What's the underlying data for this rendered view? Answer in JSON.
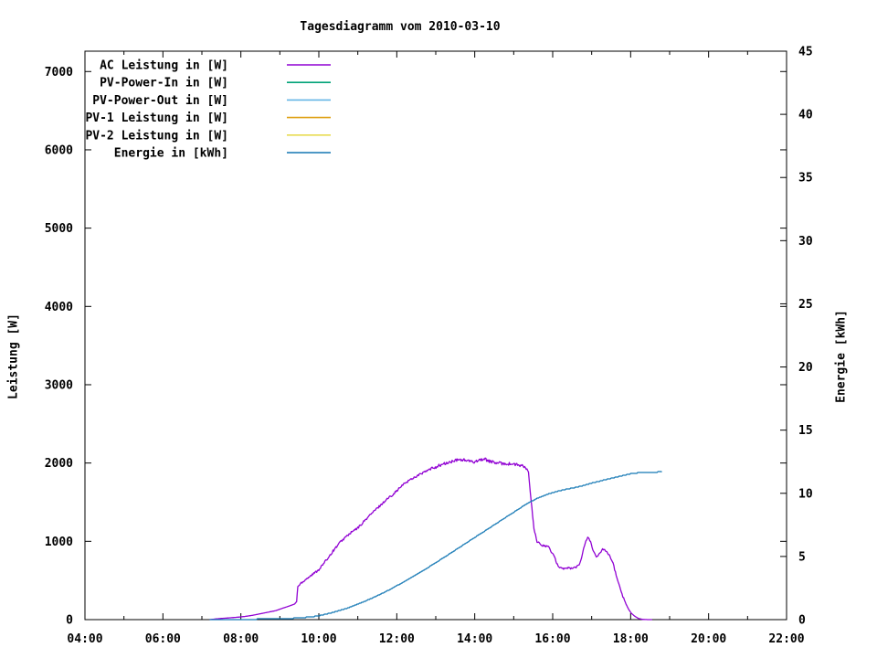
{
  "chart_data": {
    "type": "line",
    "title": "Tagesdiagramm vom 2010-03-10",
    "x_axis": {
      "range_hours": [
        4,
        22
      ],
      "major_tick_step_hours": 2,
      "minor_tick_step_hours": 1,
      "tick_labels": [
        "04:00",
        "06:00",
        "08:00",
        "10:00",
        "12:00",
        "14:00",
        "16:00",
        "18:00",
        "20:00",
        "22:00"
      ]
    },
    "y_axis": {
      "label": "Leistung [W]",
      "range": [
        0,
        7260
      ],
      "tick_step": 1000,
      "tick_labels": [
        "0",
        "1000",
        "2000",
        "3000",
        "4000",
        "5000",
        "6000",
        "7000"
      ]
    },
    "y2_axis": {
      "label": "Energie [kWh]",
      "range": [
        0,
        45
      ],
      "tick_step": 5,
      "tick_labels": [
        "0",
        "5",
        "10",
        "15",
        "20",
        "25",
        "30",
        "35",
        "40",
        "45"
      ]
    },
    "legend": {
      "position": "top-left-inside",
      "items": [
        {
          "label": "AC Leistung in [W]",
          "color": "#9102d3"
        },
        {
          "label": "PV-Power-In in [W]",
          "color": "#00a278"
        },
        {
          "label": "PV-Power-Out in [W]",
          "color": "#64b5e6"
        },
        {
          "label": "PV-1 Leistung in [W]",
          "color": "#dfa012"
        },
        {
          "label": "PV-2 Leistung in [W]",
          "color": "#e8dc52"
        },
        {
          "label": "Energie in [kWh]",
          "color": "#1377b4"
        }
      ]
    },
    "grid": "off",
    "series": [
      {
        "name": "AC Leistung in [W]",
        "axis": "y1",
        "color": "#9102d3",
        "jitter_w": 14,
        "points": [
          [
            7.2,
            0
          ],
          [
            7.35,
            8
          ],
          [
            7.5,
            15
          ],
          [
            7.7,
            22
          ],
          [
            7.9,
            30
          ],
          [
            8.1,
            40
          ],
          [
            8.3,
            55
          ],
          [
            8.5,
            75
          ],
          [
            8.7,
            95
          ],
          [
            8.9,
            115
          ],
          [
            9.1,
            150
          ],
          [
            9.25,
            175
          ],
          [
            9.38,
            200
          ],
          [
            9.43,
            230
          ],
          [
            9.46,
            420
          ],
          [
            9.55,
            470
          ],
          [
            9.7,
            530
          ],
          [
            9.85,
            580
          ],
          [
            10.0,
            640
          ],
          [
            10.1,
            700
          ],
          [
            10.25,
            800
          ],
          [
            10.4,
            900
          ],
          [
            10.55,
            990
          ],
          [
            10.7,
            1060
          ],
          [
            10.85,
            1120
          ],
          [
            11.0,
            1170
          ],
          [
            11.15,
            1250
          ],
          [
            11.3,
            1330
          ],
          [
            11.45,
            1400
          ],
          [
            11.6,
            1470
          ],
          [
            11.75,
            1540
          ],
          [
            11.9,
            1600
          ],
          [
            12.05,
            1670
          ],
          [
            12.2,
            1740
          ],
          [
            12.35,
            1790
          ],
          [
            12.5,
            1830
          ],
          [
            12.65,
            1870
          ],
          [
            12.8,
            1905
          ],
          [
            12.95,
            1940
          ],
          [
            13.1,
            1970
          ],
          [
            13.3,
            2000
          ],
          [
            13.5,
            2030
          ],
          [
            13.65,
            2045
          ],
          [
            13.8,
            2030
          ],
          [
            13.95,
            2010
          ],
          [
            14.1,
            2040
          ],
          [
            14.25,
            2050
          ],
          [
            14.4,
            2020
          ],
          [
            14.55,
            2000
          ],
          [
            14.7,
            1995
          ],
          [
            14.85,
            1990
          ],
          [
            15.0,
            1985
          ],
          [
            15.1,
            1975
          ],
          [
            15.2,
            1965
          ],
          [
            15.3,
            1945
          ],
          [
            15.38,
            1880
          ],
          [
            15.45,
            1500
          ],
          [
            15.52,
            1150
          ],
          [
            15.6,
            1000
          ],
          [
            15.68,
            955
          ],
          [
            15.78,
            945
          ],
          [
            15.88,
            935
          ],
          [
            15.95,
            880
          ],
          [
            16.05,
            790
          ],
          [
            16.12,
            700
          ],
          [
            16.2,
            665
          ],
          [
            16.3,
            650
          ],
          [
            16.4,
            660
          ],
          [
            16.5,
            655
          ],
          [
            16.6,
            670
          ],
          [
            16.68,
            700
          ],
          [
            16.78,
            870
          ],
          [
            16.85,
            1010
          ],
          [
            16.9,
            1050
          ],
          [
            16.97,
            1000
          ],
          [
            17.05,
            870
          ],
          [
            17.12,
            790
          ],
          [
            17.2,
            840
          ],
          [
            17.28,
            905
          ],
          [
            17.35,
            890
          ],
          [
            17.45,
            830
          ],
          [
            17.55,
            720
          ],
          [
            17.63,
            560
          ],
          [
            17.72,
            420
          ],
          [
            17.8,
            300
          ],
          [
            17.88,
            200
          ],
          [
            17.95,
            130
          ],
          [
            18.02,
            80
          ],
          [
            18.1,
            45
          ],
          [
            18.2,
            15
          ],
          [
            18.3,
            3
          ],
          [
            18.45,
            0
          ],
          [
            18.55,
            0
          ]
        ]
      },
      {
        "name": "Energie in [kWh]",
        "axis": "y2",
        "color": "#1377b4",
        "jitter_w": 0,
        "points": [
          [
            7.2,
            0
          ],
          [
            7.6,
            0.01
          ],
          [
            8.0,
            0.02
          ],
          [
            8.5,
            0.04
          ],
          [
            9.0,
            0.07
          ],
          [
            9.3,
            0.1
          ],
          [
            9.6,
            0.16
          ],
          [
            9.8,
            0.22
          ],
          [
            10.0,
            0.3
          ],
          [
            10.2,
            0.44
          ],
          [
            10.4,
            0.6
          ],
          [
            10.6,
            0.78
          ],
          [
            10.8,
            0.98
          ],
          [
            11.0,
            1.22
          ],
          [
            11.2,
            1.48
          ],
          [
            11.4,
            1.75
          ],
          [
            11.6,
            2.04
          ],
          [
            11.8,
            2.35
          ],
          [
            12.0,
            2.68
          ],
          [
            12.2,
            3.02
          ],
          [
            12.4,
            3.38
          ],
          [
            12.6,
            3.75
          ],
          [
            12.8,
            4.12
          ],
          [
            13.0,
            4.5
          ],
          [
            13.2,
            4.9
          ],
          [
            13.4,
            5.3
          ],
          [
            13.6,
            5.7
          ],
          [
            13.8,
            6.1
          ],
          [
            14.0,
            6.5
          ],
          [
            14.2,
            6.9
          ],
          [
            14.4,
            7.3
          ],
          [
            14.6,
            7.7
          ],
          [
            14.8,
            8.1
          ],
          [
            15.0,
            8.5
          ],
          [
            15.2,
            8.9
          ],
          [
            15.4,
            9.28
          ],
          [
            15.6,
            9.6
          ],
          [
            15.8,
            9.85
          ],
          [
            16.0,
            10.05
          ],
          [
            16.2,
            10.22
          ],
          [
            16.4,
            10.35
          ],
          [
            16.6,
            10.47
          ],
          [
            16.8,
            10.62
          ],
          [
            17.0,
            10.8
          ],
          [
            17.2,
            10.96
          ],
          [
            17.4,
            11.12
          ],
          [
            17.6,
            11.26
          ],
          [
            17.8,
            11.4
          ],
          [
            18.0,
            11.55
          ],
          [
            18.2,
            11.62
          ],
          [
            18.4,
            11.66
          ],
          [
            18.6,
            11.68
          ],
          [
            18.8,
            11.69
          ]
        ]
      }
    ]
  }
}
